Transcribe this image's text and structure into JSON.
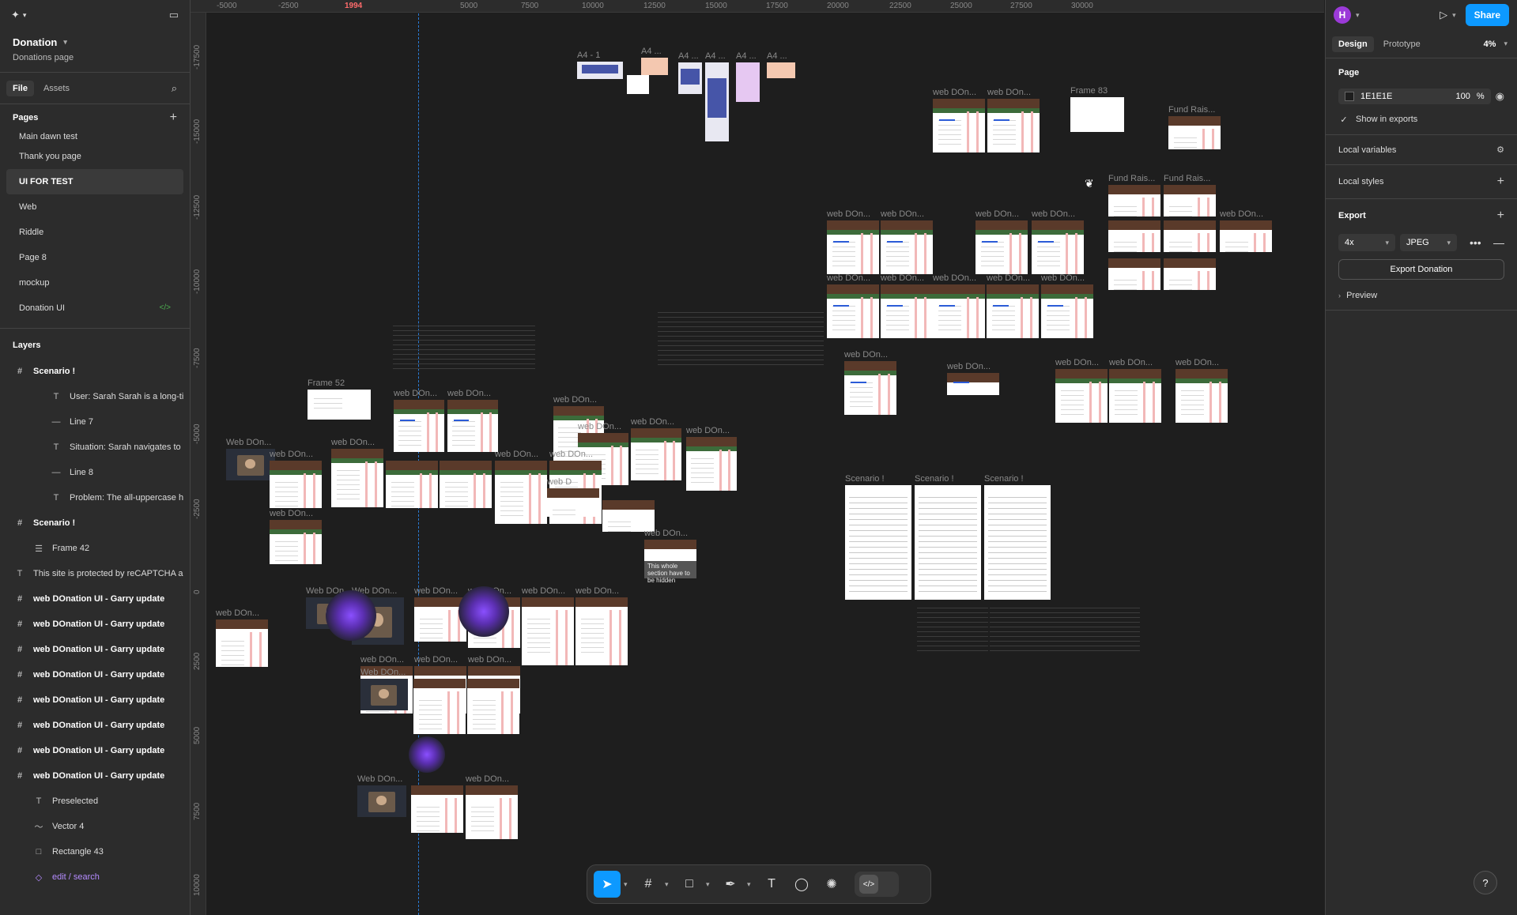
{
  "file": {
    "name": "Donation",
    "subtitle": "Donations page"
  },
  "left_tabs": {
    "file": "File",
    "assets": "Assets"
  },
  "pages": {
    "title": "Pages",
    "items": [
      {
        "label": "Main dawn test"
      },
      {
        "label": "Thank you page"
      },
      {
        "label": "UI FOR TEST",
        "selected": true
      },
      {
        "label": "Web"
      },
      {
        "label": "Riddle"
      },
      {
        "label": "Page 8"
      },
      {
        "label": "mockup"
      },
      {
        "label": "Donation UI",
        "badge": "</>"
      }
    ]
  },
  "layers": {
    "title": "Layers",
    "items": [
      {
        "label": "Scenario !",
        "icon": "frame-icon",
        "level": 0
      },
      {
        "label": "User: Sarah Sarah is a long-ti",
        "icon": "text-icon",
        "level": 2
      },
      {
        "label": "Line 7",
        "icon": "line-icon",
        "level": 2
      },
      {
        "label": "Situation: Sarah navigates to",
        "icon": "text-icon",
        "level": 2
      },
      {
        "label": "Line 8",
        "icon": "line-icon",
        "level": 2
      },
      {
        "label": "Problem: The all-uppercase h",
        "icon": "text-icon",
        "level": 2
      },
      {
        "label": "Scenario !",
        "icon": "frame-icon",
        "level": 0
      },
      {
        "label": "Frame 42",
        "icon": "stack-icon",
        "level": 1
      },
      {
        "label": "This site is protected by reCAPTCHA a",
        "icon": "text-icon",
        "level": 0
      },
      {
        "label": "web DOnation UI - Garry update",
        "icon": "frame-icon",
        "level": 0
      },
      {
        "label": "web DOnation UI - Garry update",
        "icon": "frame-icon",
        "level": 0
      },
      {
        "label": "web DOnation UI - Garry update",
        "icon": "frame-icon",
        "level": 0
      },
      {
        "label": "web DOnation UI - Garry update",
        "icon": "frame-icon",
        "level": 0
      },
      {
        "label": "web DOnation UI - Garry update",
        "icon": "frame-icon",
        "level": 0
      },
      {
        "label": "web DOnation UI - Garry update",
        "icon": "frame-icon",
        "level": 0
      },
      {
        "label": "web DOnation UI - Garry update",
        "icon": "frame-icon",
        "level": 0
      },
      {
        "label": "web DOnation UI - Garry update",
        "icon": "frame-icon",
        "level": 0
      },
      {
        "label": "Preselected",
        "icon": "text-icon",
        "level": 1
      },
      {
        "label": "Vector 4",
        "icon": "vector-icon",
        "level": 1
      },
      {
        "label": "Rectangle 43",
        "icon": "rectangle-icon",
        "level": 1
      },
      {
        "label": "edit / search",
        "icon": "component-icon",
        "level": 1,
        "component": true
      }
    ]
  },
  "ruler": {
    "x_ticks": [
      "-5000",
      "-2500",
      "1994",
      "5000",
      "7500",
      "10000",
      "12500",
      "15000",
      "17500",
      "20000",
      "22500",
      "25000",
      "27500",
      "30000"
    ],
    "y_ticks": [
      "-17500",
      "-15000",
      "-12500",
      "-10000",
      "-7500",
      "-5000",
      "-2500",
      "0",
      "2500",
      "5000",
      "7500",
      "10000"
    ]
  },
  "canvas": {
    "labels": {
      "a4_1": "A4 - 1",
      "a4": "A4 ...",
      "frame83": "Frame 83",
      "frame52": "Frame 52",
      "fund": "Fund Rais...",
      "webdon": "web DOn...",
      "webDon": "Web DOn...",
      "scenario": "Scenario !",
      "webd": "web D",
      "hide_note": "This whole section have to be hidden"
    }
  },
  "toolbar": {
    "tools": [
      "move-icon",
      "frame-icon",
      "rectangle-icon",
      "pen-icon",
      "text-icon",
      "comment-icon",
      "actions-icon"
    ],
    "dev_mode": "</>"
  },
  "right_panel": {
    "avatar": "H",
    "share": "Share",
    "tabs": {
      "design": "Design",
      "prototype": "Prototype"
    },
    "zoom": "4%",
    "page": {
      "title": "Page",
      "bg_color": "1E1E1E",
      "opacity": "100",
      "opacity_unit": "%",
      "show_in_exports": "Show in exports"
    },
    "local_variables": "Local variables",
    "local_styles": "Local styles",
    "export": {
      "title": "Export",
      "scale": "4x",
      "format": "JPEG",
      "button": "Export Donation",
      "preview": "Preview"
    }
  },
  "help": "?",
  "colors": {
    "accent": "#0d99ff",
    "canvas_bg": "#1e1e1e",
    "panel_bg": "#2c2c2c",
    "avatar": "#9b3ad8"
  }
}
